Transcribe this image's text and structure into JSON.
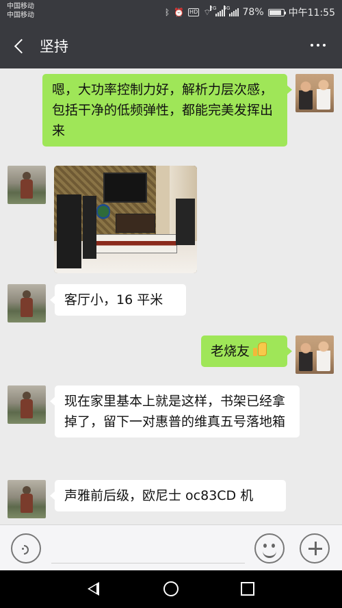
{
  "status_bar": {
    "carrier_1": "中国移动",
    "carrier_2": "中国移动",
    "battery": "78%",
    "time": "中午11:55",
    "hd_badge": "HD",
    "net_1": "2G",
    "net_2": "4G"
  },
  "header": {
    "title": "坚持"
  },
  "messages": [
    {
      "side": "right",
      "type": "text",
      "text": "嗯，大功率控制力好，解析力层次感，包括干净的低频弹性，都能完美发挥出来"
    },
    {
      "side": "left",
      "type": "image",
      "description": "photo"
    },
    {
      "side": "left",
      "type": "text",
      "text": "客厅小，16 平米"
    },
    {
      "side": "right",
      "type": "text",
      "text": "老烧友",
      "emoji": "thumbs-up"
    },
    {
      "side": "left",
      "type": "text",
      "text": "现在家里基本上就是这样，书架已经拿掉了，留下一对惠普的维真五号落地箱"
    },
    {
      "side": "left",
      "type": "text",
      "text": "声雅前后级，欧尼士 oc83CD 机"
    }
  ],
  "input_bar": {
    "placeholder": ""
  },
  "colors": {
    "header_bg": "#393a3f",
    "chat_bg": "#ebebeb",
    "outgoing_bubble": "#9fe658",
    "incoming_bubble": "#ffffff"
  }
}
